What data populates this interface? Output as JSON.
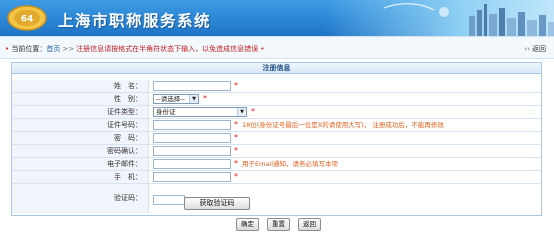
{
  "header": {
    "logo_text": "64",
    "title": "上海市职称服务系统"
  },
  "breadcrumb": {
    "prefix": "当前位置：",
    "home": "首页",
    "separator": ">>",
    "hint": "注册信息请按格式在半角符状态下输入，以免造成信息错误"
  },
  "back": {
    "label": "返回"
  },
  "form": {
    "title": "注册信息",
    "fields": [
      {
        "label": "姓　名：",
        "value": "",
        "required": "*"
      },
      {
        "label": "性　别：",
        "value": "--请选择--",
        "required": "*"
      },
      {
        "label": "证件类型：",
        "value": "身份证",
        "required": "*"
      },
      {
        "label": "证件号码：",
        "value": "",
        "required": "*",
        "note": "18位(身份证号最后一位是X的请使用大写)， 注册成功后，不能再修改"
      },
      {
        "label": "密　码：",
        "value": "",
        "required": "*"
      },
      {
        "label": "密码确认：",
        "value": "",
        "required": "*"
      },
      {
        "label": "电子邮件：",
        "value": "",
        "required": "*",
        "note": "用于Email通知，请务必填写本项"
      },
      {
        "label": "手　机：",
        "value": "",
        "required": "*"
      },
      {
        "label": "验证码：",
        "value": ""
      }
    ],
    "captcha_button": "获取验证码",
    "actions": {
      "confirm": "确定",
      "reset": "重置",
      "back": "返回"
    }
  },
  "colors": {
    "header_blue": "#2b86d6",
    "required_red": "#e02020",
    "note_orange": "#e06020",
    "border_blue": "#a9c7e6"
  }
}
